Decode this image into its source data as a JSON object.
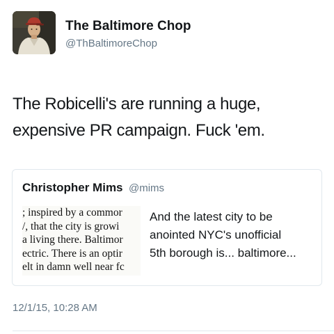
{
  "author": {
    "display_name": "The Baltimore Chop",
    "handle": "@ThBaltimoreChop",
    "avatar_icon": "vintage-baseball-player-photo"
  },
  "tweet": {
    "text_lines": [
      "The Robicelli's are running a huge,",
      "expensive PR campaign. Fuck 'em."
    ],
    "timestamp": "12/1/15, 10:28 AM"
  },
  "quoted_tweet": {
    "display_name": "Christopher Mims",
    "handle": "@mims",
    "text_lines": [
      "And the latest city to be",
      "anointed NYC's unofficial",
      "5th borough is... baltimore..."
    ],
    "thumbnail_lines": [
      "; inspired by a commor",
      "/, that the city is growi",
      "a living there. Baltimor",
      "ectric. There is an optir",
      "elt in damn well near fc"
    ]
  },
  "colors": {
    "text": "#14171a",
    "secondary": "#657786",
    "border": "#e1e8ed"
  }
}
